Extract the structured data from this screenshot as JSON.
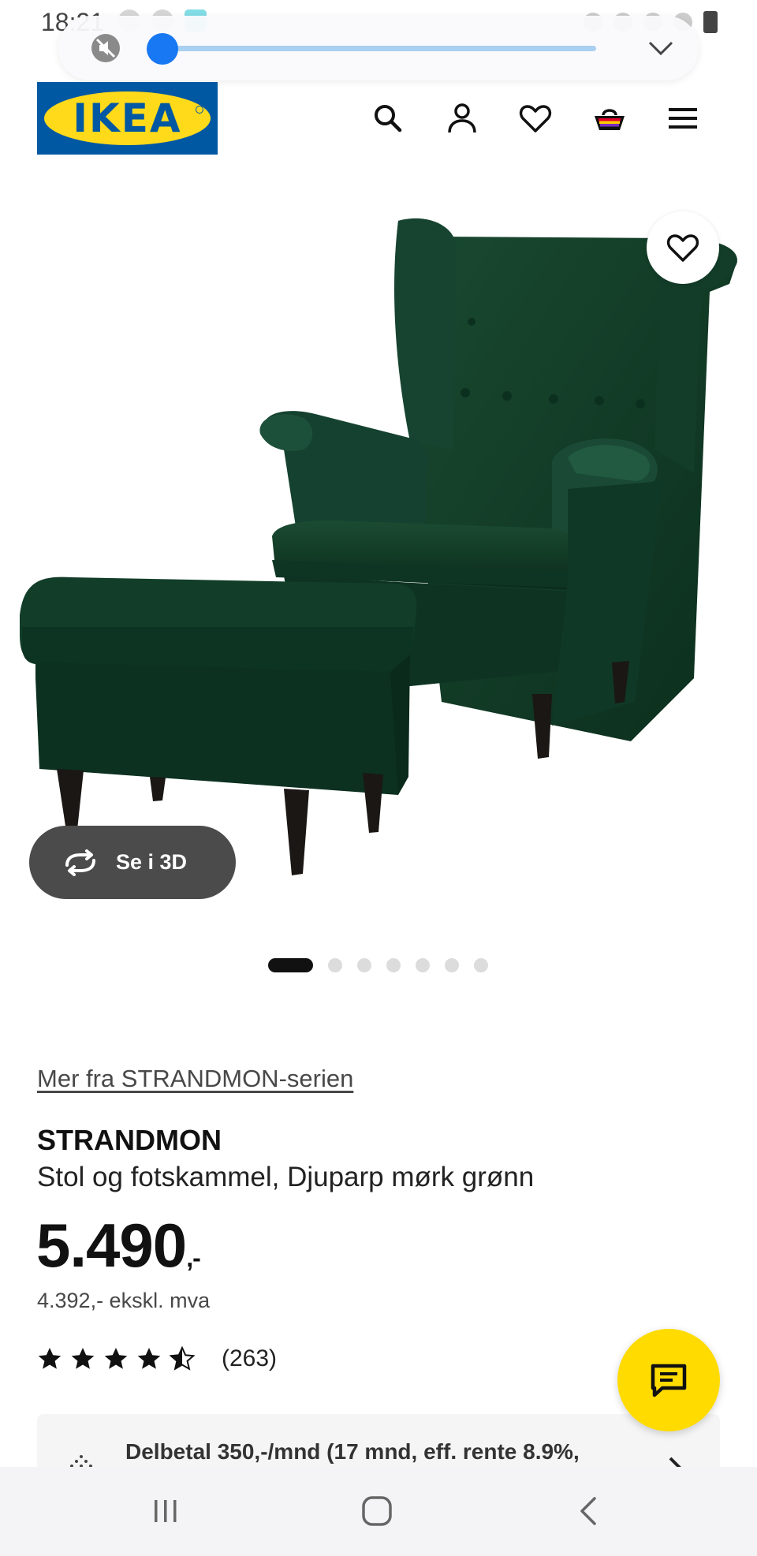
{
  "status_bar": {
    "time": "18:21"
  },
  "media_overlay": {
    "volume_level": 0.03,
    "mute_icon": "sound-off-icon",
    "expand_icon": "chevron-down-icon"
  },
  "header": {
    "logo_text": "IKEA",
    "icons": [
      "search-icon",
      "user-icon",
      "heart-icon",
      "basket-icon",
      "menu-icon"
    ]
  },
  "product_image": {
    "alt": "STRANDMON",
    "view_3d_label": "Se i 3D",
    "carousel_count": 7,
    "carousel_active_index": 0
  },
  "product": {
    "series_link": "Mer fra STRANDMON-serien",
    "name": "STRANDMON",
    "description": "Stol og fotskammel, Djuparp mørk grønn",
    "price_main": "5.490",
    "price_suffix": ",-",
    "price_excl_vat": "4.392,- ekskl. mva",
    "rating_stars": 4.5,
    "rating_count": "(263)"
  },
  "payment_banner": {
    "text": "Delbetal 350,-/mnd (17 mnd, eff. rente 8.9%,"
  },
  "colors": {
    "ikea_blue": "#0058a3",
    "ikea_yellow": "#ffda1a",
    "chat_yellow": "#ffdb00",
    "chair_green": "#0f3b26",
    "volume_blue": "#1877f2"
  }
}
